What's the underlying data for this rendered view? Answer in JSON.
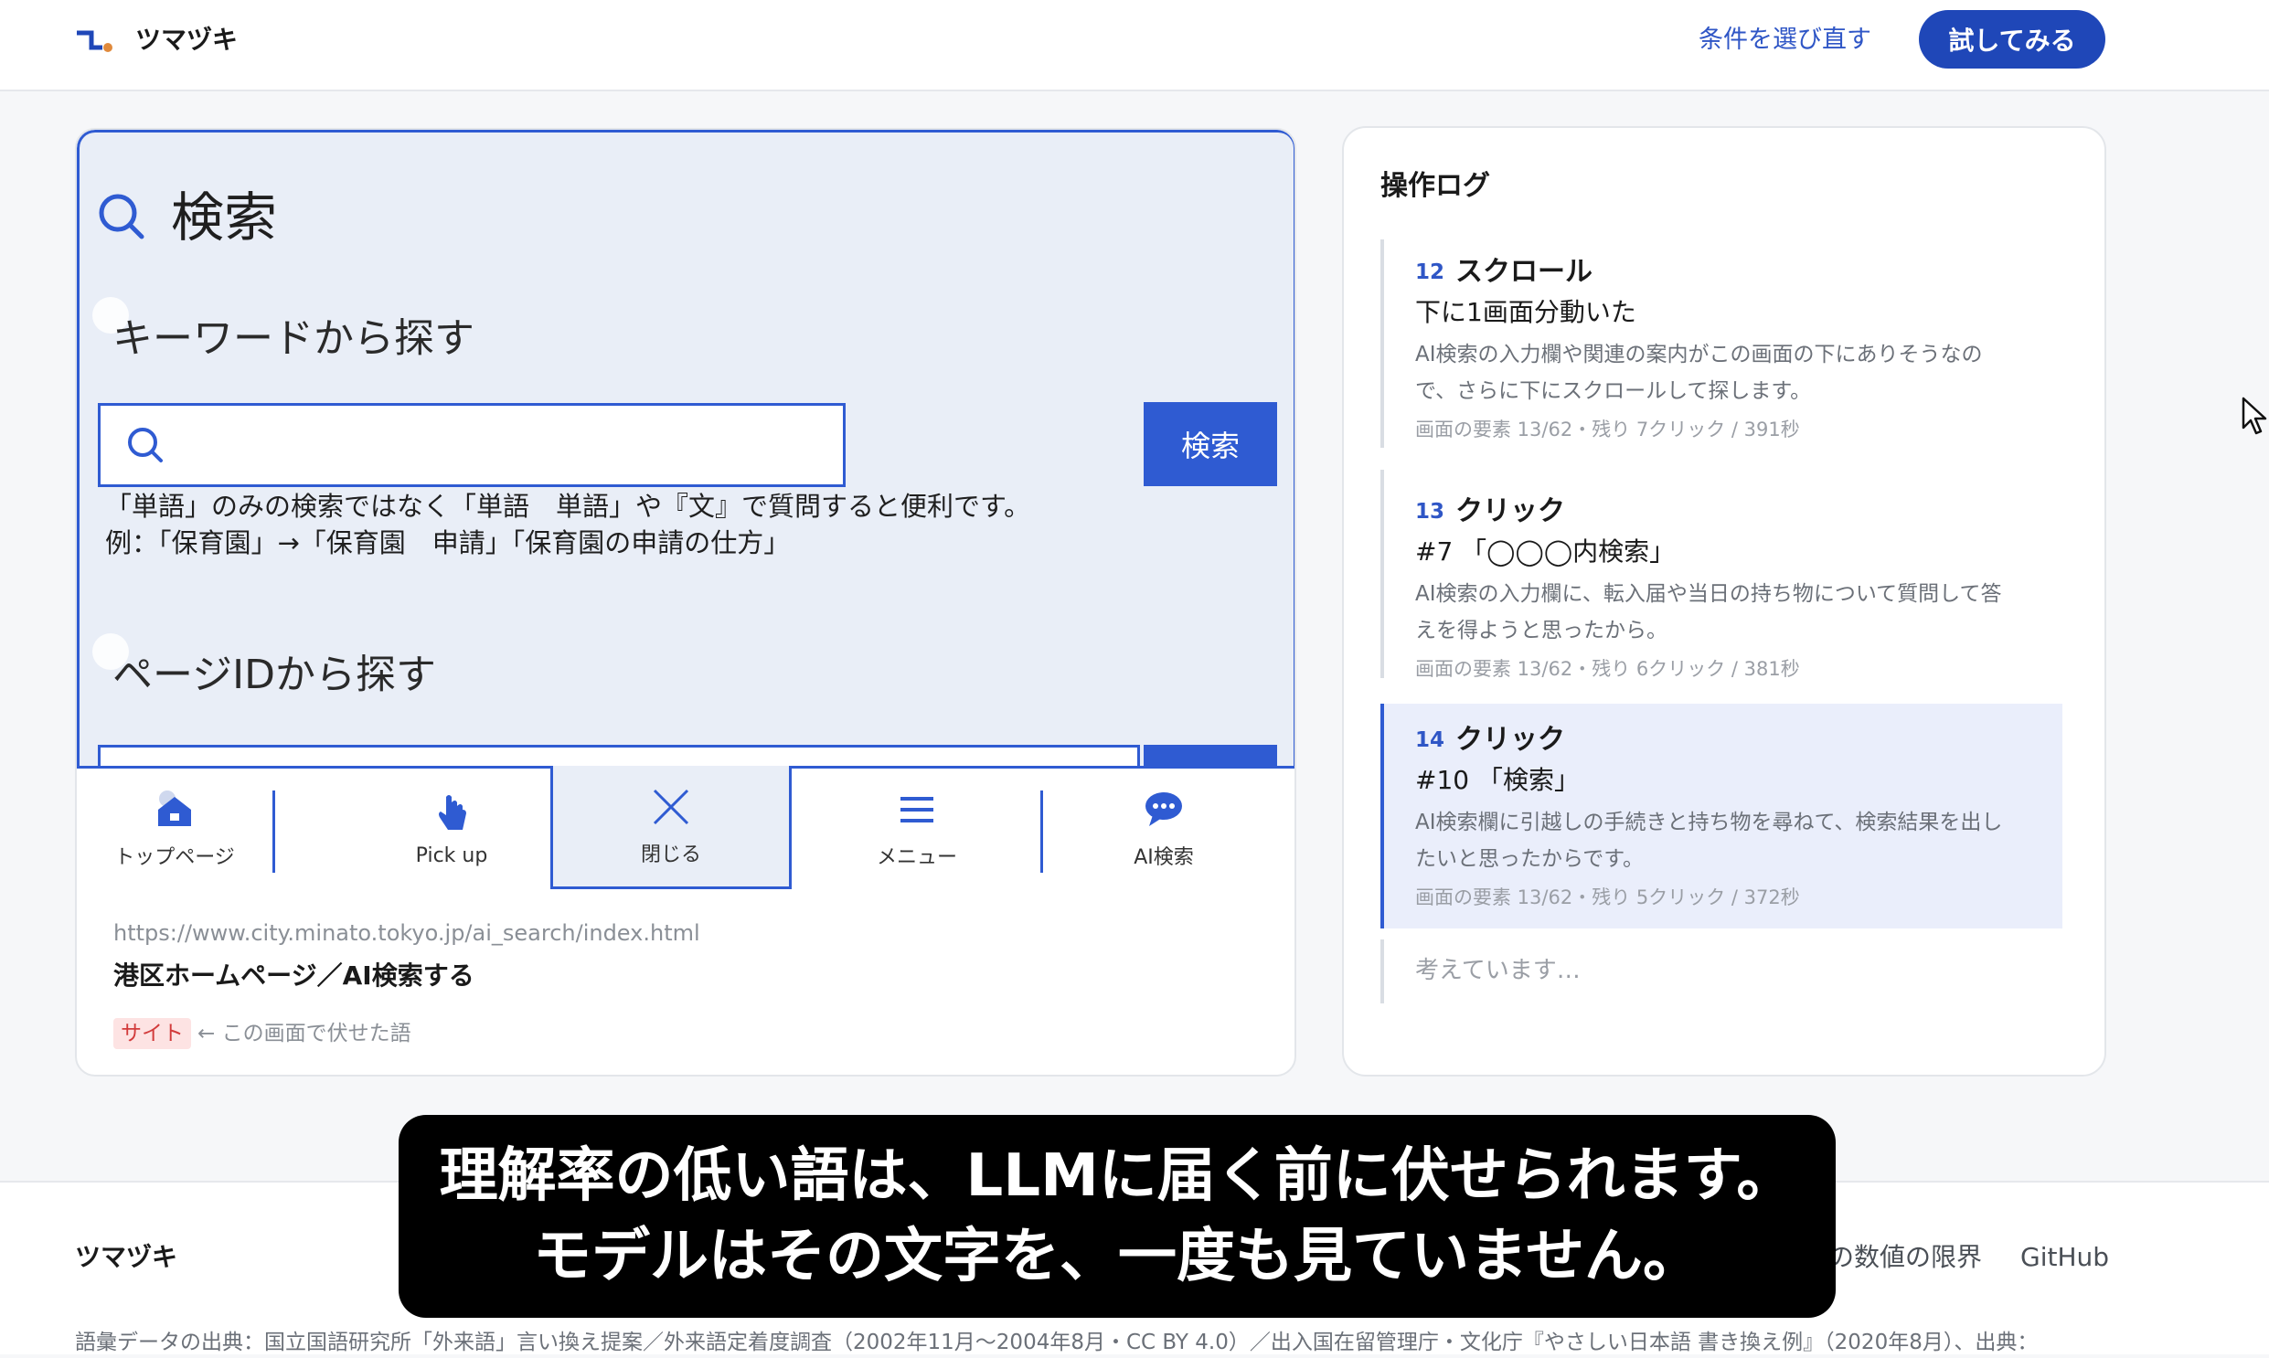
{
  "header": {
    "app_name": "ツマヅキ",
    "reselect_label": "条件を選び直す",
    "try_label": "試してみる"
  },
  "preview": {
    "search_title": "検索",
    "keyword_heading": "キーワードから探す",
    "search_button_label": "検索",
    "hint_line_1": "「単語」のみの検索ではなく「単語　単語」や『文』で質問すると便利です。",
    "hint_line_2": "例：「保育園」→「保育園　申請」「保育園の申請の仕方」",
    "pageid_heading": "ページIDから探す",
    "nav": [
      {
        "label": "トップページ",
        "icon": "home-icon"
      },
      {
        "label": "Pick up",
        "icon": "hand-pointer-icon"
      },
      {
        "label": "閉じる",
        "icon": "close-icon"
      },
      {
        "label": "メニュー",
        "icon": "menu-icon"
      },
      {
        "label": "AI検索",
        "icon": "chat-bubble-icon"
      }
    ],
    "url": "https://www.city.minato.tokyo.jp/ai_search/index.html",
    "page_title": "港区ホームページ／AI検索する",
    "masked_badge": "サイト",
    "masked_note": "← この画面で伏せた語"
  },
  "log": {
    "title": "操作ログ",
    "entries": [
      {
        "num": "12",
        "action": "スクロール",
        "detail": "下に1画面分動いた",
        "reason_1": "AI検索の入力欄や関連の案内がこの画面の下にありそうなの",
        "reason_2": "で、さらに下にスクロールして探します。",
        "meta": "画面の要素 13/62・残り 7クリック / 391秒"
      },
      {
        "num": "13",
        "action": "クリック",
        "detail": "#7 「◯◯◯内検索」",
        "reason_1": "AI検索の入力欄に、転入届や当日の持ち物について質問して答",
        "reason_2": "えを得ようと思ったから。",
        "meta": "画面の要素 13/62・残り 6クリック / 381秒"
      },
      {
        "num": "14",
        "action": "クリック",
        "detail": "#10 「検索」",
        "reason_1": "AI検索欄に引越しの手続きと持ち物を尋ねて、検索結果を出し",
        "reason_2": "たいと思ったからです。",
        "meta": "画面の要素 13/62・残り 5クリック / 372秒"
      }
    ],
    "thinking": "考えています…"
  },
  "footer": {
    "brand": "ツマヅキ",
    "link_limits": "の数値の限界",
    "link_github": "GitHub",
    "source_note": "語彙データの出典：国立国語研究所「外来語」言い換え提案／外来語定着度調査（2002年11月〜2004年8月・CC BY 4.0）／出入国在留管理庁・文化庁『やさしい日本語 書き換え例』（2020年8月）、出典："
  },
  "subtitle": {
    "line_1": "理解率の低い語は、LLMに届く前に伏せられます。",
    "line_2": "モデルはその文字を、一度も見ていません。"
  },
  "colors": {
    "accent": "#1f47b8",
    "screenshot_highlight": "#2f5bd2",
    "screenshot_bg": "#e9eef7",
    "active_log_bg": "#eaeefb",
    "masked_badge_bg": "#fde3e3",
    "masked_badge_text": "#d23b3b"
  }
}
